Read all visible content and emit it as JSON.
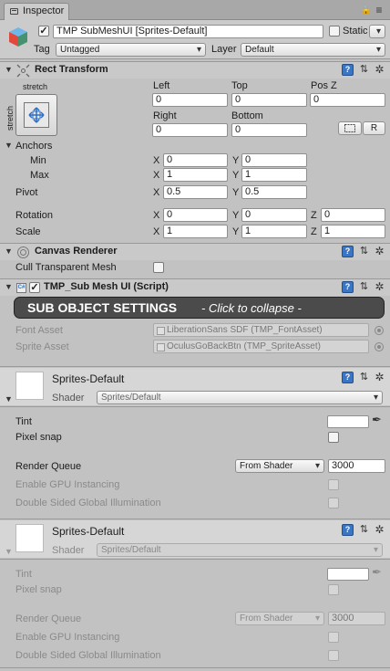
{
  "window": {
    "tab_label": "Inspector"
  },
  "header": {
    "object_active": true,
    "object_name": "TMP SubMeshUI [Sprites-Default]",
    "static_label": "Static",
    "static_checked": false,
    "tag_label": "Tag",
    "tag_value": "Untagged",
    "layer_label": "Layer",
    "layer_value": "Default"
  },
  "rect_transform": {
    "title": "Rect Transform",
    "anchor_preset_top": "stretch",
    "anchor_preset_side": "stretch",
    "left_label": "Left",
    "top_label": "Top",
    "posz_label": "Pos Z",
    "left_value": "0",
    "top_value": "0",
    "posz_value": "0",
    "right_label": "Right",
    "bottom_label": "Bottom",
    "right_value": "0",
    "bottom_value": "0",
    "raw_button": "R",
    "anchors_label": "Anchors",
    "min_label": "Min",
    "max_label": "Max",
    "min_x": "0",
    "min_y": "0",
    "max_x": "1",
    "max_y": "1",
    "pivot_label": "Pivot",
    "pivot_x": "0.5",
    "pivot_y": "0.5",
    "rotation_label": "Rotation",
    "rot_x": "0",
    "rot_y": "0",
    "rot_z": "0",
    "scale_label": "Scale",
    "scale_x": "1",
    "scale_y": "1",
    "scale_z": "1",
    "axis_x": "X",
    "axis_y": "Y",
    "axis_z": "Z"
  },
  "canvas_renderer": {
    "title": "Canvas Renderer",
    "cull_label": "Cull Transparent Mesh",
    "cull_checked": false
  },
  "tmp_script": {
    "enabled": true,
    "title": "TMP_Sub Mesh UI (Script)",
    "script_badge": "C#",
    "collapse_bold": "SUB OBJECT SETTINGS",
    "collapse_hint": "- Click to collapse -",
    "font_asset_label": "Font Asset",
    "font_asset_value": "LiberationSans SDF (TMP_FontAsset)",
    "sprite_asset_label": "Sprite Asset",
    "sprite_asset_value": "OculusGoBackBtn (TMP_SpriteAsset)"
  },
  "materials": [
    {
      "name": "Sprites-Default",
      "shader_label": "Shader",
      "shader_value": "Sprites/Default",
      "tint_label": "Tint",
      "pixel_snap_label": "Pixel snap",
      "render_queue_label": "Render Queue",
      "render_queue_mode": "From Shader",
      "render_queue_value": "3000",
      "gpu_instancing_label": "Enable GPU Instancing",
      "double_sided_label": "Double Sided Global Illumination"
    },
    {
      "name": "Sprites-Default",
      "shader_label": "Shader",
      "shader_value": "Sprites/Default",
      "tint_label": "Tint",
      "pixel_snap_label": "Pixel snap",
      "render_queue_label": "Render Queue",
      "render_queue_mode": "From Shader",
      "render_queue_value": "3000",
      "gpu_instancing_label": "Enable GPU Instancing",
      "double_sided_label": "Double Sided Global Illumination"
    }
  ],
  "icons": {
    "help": "?",
    "preset": "⇅",
    "gear": "✲"
  },
  "colors": {
    "tint": "#ffffff",
    "help_button": "#3b76c4",
    "collapse_bar": "#4b4b4b"
  }
}
